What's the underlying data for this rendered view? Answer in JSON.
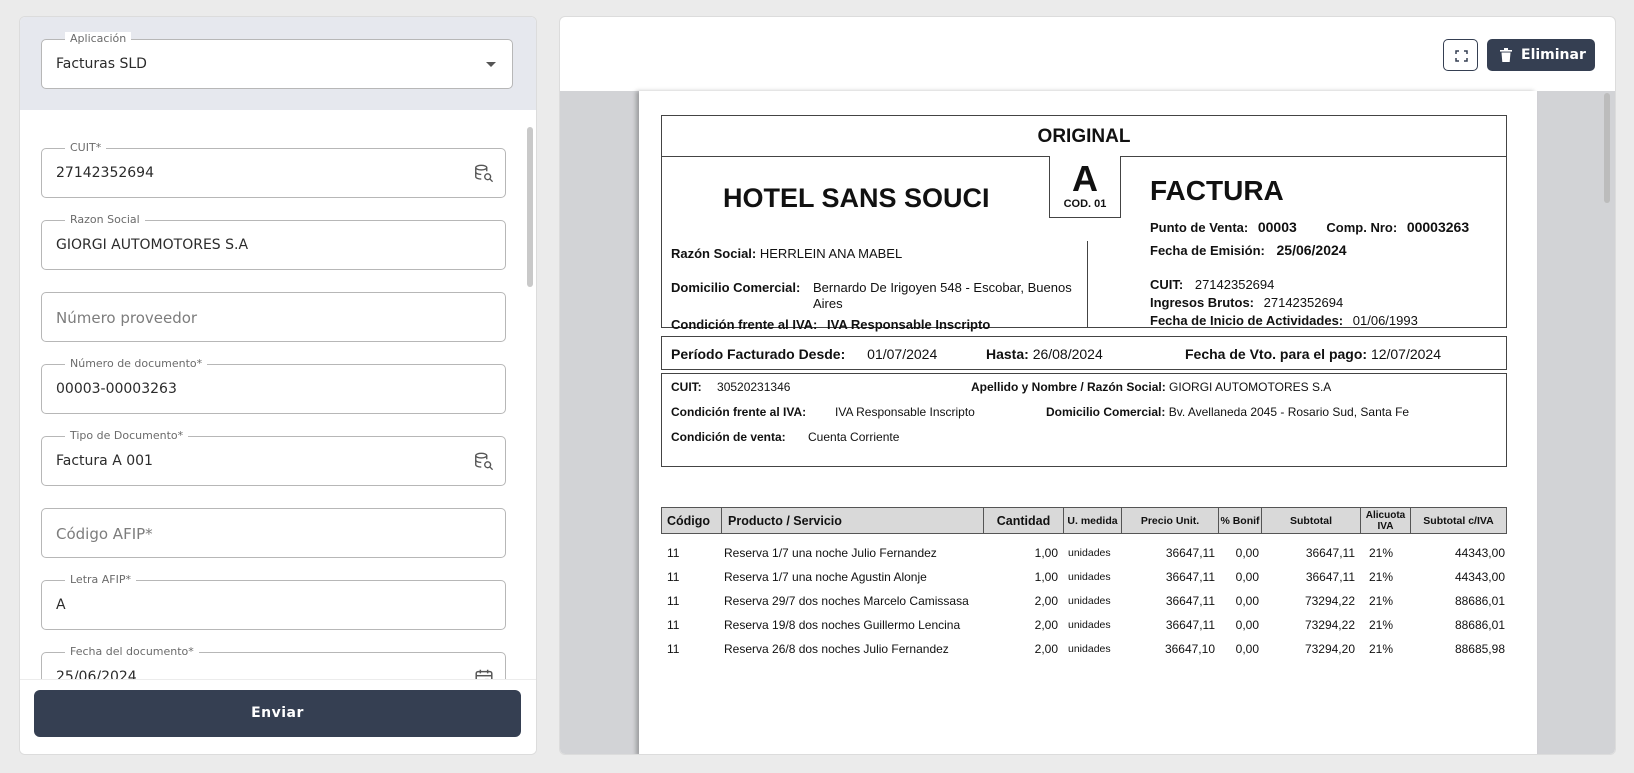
{
  "form": {
    "aplicacion": {
      "label": "Aplicación",
      "value": "Facturas SLD"
    },
    "cuit": {
      "label": "CUIT*",
      "value": "27142352694"
    },
    "razon_social": {
      "label": "Razon Social",
      "value": "GIORGI AUTOMOTORES S.A"
    },
    "numero_proveedor": {
      "placeholder": "Número proveedor"
    },
    "numero_documento": {
      "label": "Número de documento*",
      "value": "00003-00003263"
    },
    "tipo_documento": {
      "label": "Tipo de Documento*",
      "value": "Factura A 001"
    },
    "codigo_afip": {
      "placeholder": "Código AFIP*"
    },
    "letra_afip": {
      "label": "Letra AFIP*",
      "value": "A"
    },
    "fecha_documento": {
      "label": "Fecha del documento*",
      "value": "25/06/2024"
    },
    "submit_label": "Enviar"
  },
  "viewer": {
    "delete_label": "Eliminar"
  },
  "invoice": {
    "copy": "ORIGINAL",
    "company": "HOTEL SANS SOUCI",
    "letter": "A",
    "code": "COD. 01",
    "doc_type": "FACTURA",
    "issuer": {
      "razon_social_label": "Razón Social:",
      "razon_social": "HERRLEIN ANA MABEL",
      "domicilio_label": "Domicilio Comercial:",
      "domicilio_line1": "Bernardo De Irigoyen 548 - Escobar, Buenos",
      "domicilio_line2": "Aires",
      "iva_label": "Condición frente al IVA:",
      "iva": "IVA Responsable Inscripto"
    },
    "header_right": {
      "punto_venta_label": "Punto de Venta:",
      "punto_venta": "00003",
      "comp_nro_label": "Comp. Nro:",
      "comp_nro": "00003263",
      "fecha_emision_label": "Fecha de Emisión:",
      "fecha_emision": "25/06/2024",
      "cuit_label": "CUIT:",
      "cuit": "27142352694",
      "ingresos_label": "Ingresos Brutos:",
      "ingresos": "27142352694",
      "inicio_label": "Fecha de Inicio de Actividades:",
      "inicio": "01/06/1993"
    },
    "period": {
      "desde_label": "Período Facturado Desde:",
      "desde": "01/07/2024",
      "hasta_label": "Hasta:",
      "hasta": "26/08/2024",
      "vto_label": "Fecha de Vto. para el pago:",
      "vto": "12/07/2024"
    },
    "client": {
      "cuit_label": "CUIT:",
      "cuit": "30520231346",
      "nombre_label": "Apellido y Nombre / Razón Social:",
      "nombre": "GIORGI AUTOMOTORES S.A",
      "iva_label": "Condición frente al IVA:",
      "iva": "IVA Responsable Inscripto",
      "domicilio_label": "Domicilio Comercial:",
      "domicilio": "Bv. Avellaneda 2045 - Rosario Sud, Santa Fe",
      "venta_label": "Condición de venta:",
      "venta": "Cuenta Corriente"
    },
    "columns": [
      "Código",
      "Producto / Servicio",
      "Cantidad",
      "U. medida",
      "Precio Unit.",
      "% Bonif",
      "Subtotal",
      "Alicuota IVA",
      "Subtotal c/IVA"
    ],
    "items": [
      {
        "codigo": "11",
        "producto": "Reserva 1/7 una noche Julio Fernandez",
        "cantidad": "1,00",
        "umedida": "unidades",
        "precio": "36647,11",
        "bonif": "0,00",
        "subtotal": "36647,11",
        "alicuota": "21%",
        "total": "44343,00"
      },
      {
        "codigo": "11",
        "producto": "Reserva 1/7 una noche Agustin Alonje",
        "cantidad": "1,00",
        "umedida": "unidades",
        "precio": "36647,11",
        "bonif": "0,00",
        "subtotal": "36647,11",
        "alicuota": "21%",
        "total": "44343,00"
      },
      {
        "codigo": "11",
        "producto": "Reserva 29/7 dos noches Marcelo Camissasa",
        "cantidad": "2,00",
        "umedida": "unidades",
        "precio": "36647,11",
        "bonif": "0,00",
        "subtotal": "73294,22",
        "alicuota": "21%",
        "total": "88686,01"
      },
      {
        "codigo": "11",
        "producto": "Reserva 19/8 dos noches Guillermo Lencina",
        "cantidad": "2,00",
        "umedida": "unidades",
        "precio": "36647,11",
        "bonif": "0,00",
        "subtotal": "73294,22",
        "alicuota": "21%",
        "total": "88686,01"
      },
      {
        "codigo": "11",
        "producto": "Reserva 26/8 dos noches Julio Fernandez",
        "cantidad": "2,00",
        "umedida": "unidades",
        "precio": "36647,10",
        "bonif": "0,00",
        "subtotal": "73294,20",
        "alicuota": "21%",
        "total": "88685,98"
      }
    ]
  }
}
